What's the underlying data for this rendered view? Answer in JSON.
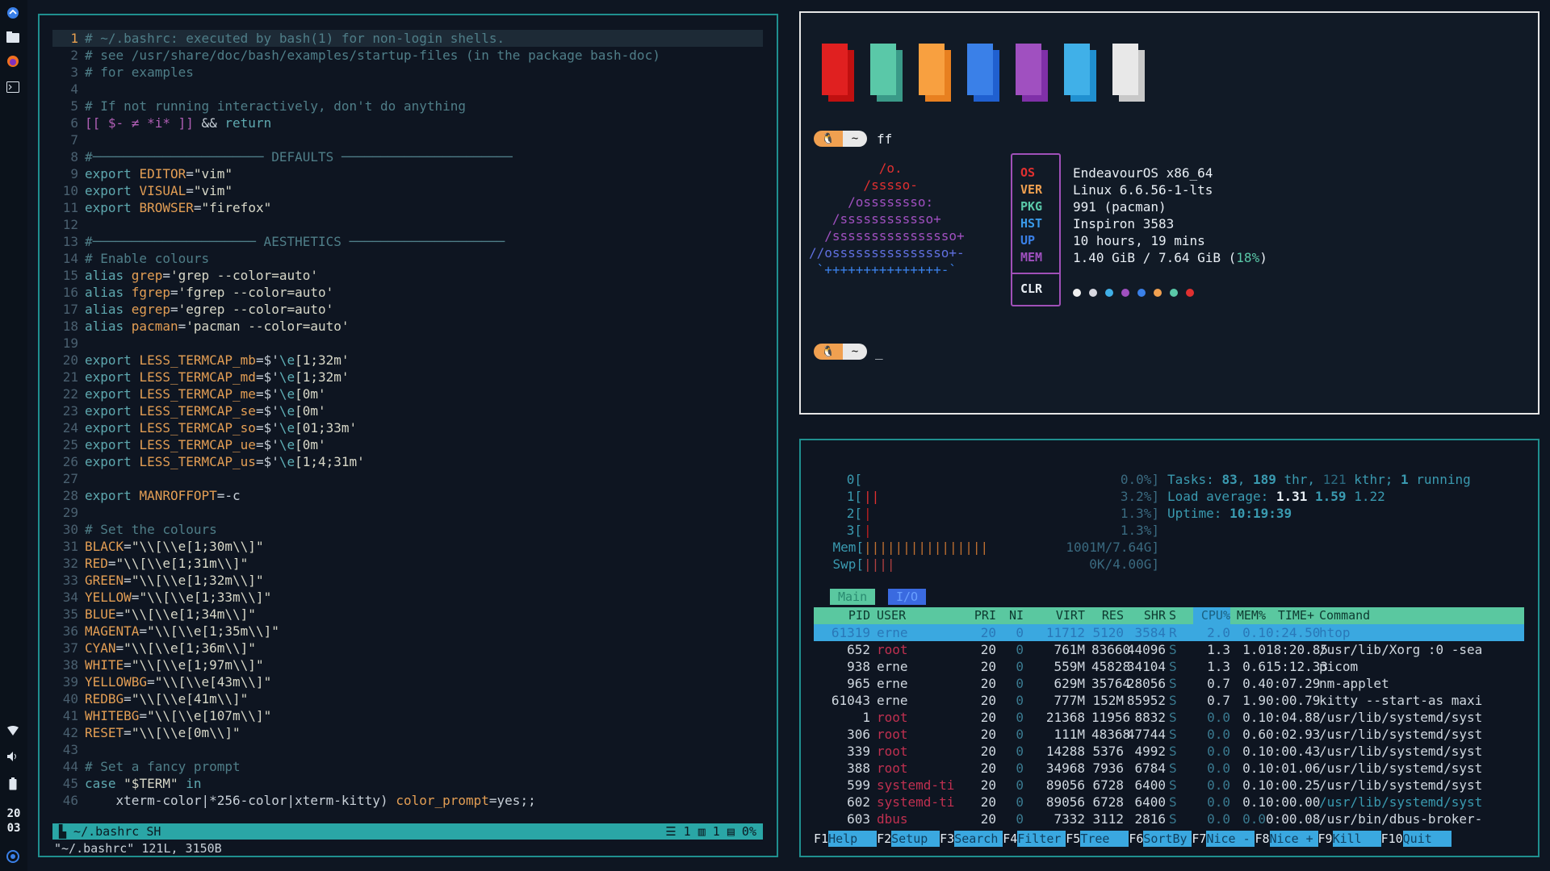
{
  "dock": {
    "icons": [
      "app-launcher-icon",
      "file-manager-icon",
      "firefox-icon",
      "terminal-icon"
    ],
    "tray_icons": [
      "wifi-icon",
      "volume-icon",
      "battery-icon",
      "power-icon"
    ],
    "clock_hour": "20",
    "clock_minute": "03"
  },
  "vim": {
    "lines": [
      {
        "n": "1",
        "segs": [
          [
            "c-com",
            "# ~/.bashrc: executed by bash(1) for non-login shells."
          ]
        ]
      },
      {
        "n": "2",
        "segs": [
          [
            "c-com",
            "# see /usr/share/doc/bash/examples/startup-files (in the package bash-doc)"
          ]
        ]
      },
      {
        "n": "3",
        "segs": [
          [
            "c-com",
            "# for examples"
          ]
        ]
      },
      {
        "n": "4",
        "segs": []
      },
      {
        "n": "5",
        "segs": [
          [
            "c-com",
            "# If not running interactively, don't do anything"
          ]
        ]
      },
      {
        "n": "6",
        "segs": [
          [
            "c-pur",
            "[[ $- ≠ *i* ]] "
          ],
          [
            "c-def",
            "&& "
          ],
          [
            "c-kw",
            "return"
          ]
        ]
      },
      {
        "n": "7",
        "segs": []
      },
      {
        "n": "8",
        "segs": [
          [
            "c-com",
            "#────────────────────── DEFAULTS ──────────────────────"
          ]
        ]
      },
      {
        "n": "9",
        "segs": [
          [
            "c-kw",
            "export "
          ],
          [
            "c-var",
            "EDITOR"
          ],
          [
            "c-def",
            "="
          ],
          [
            "c-str",
            "\"vim\""
          ]
        ]
      },
      {
        "n": "10",
        "segs": [
          [
            "c-kw",
            "export "
          ],
          [
            "c-var",
            "VISUAL"
          ],
          [
            "c-def",
            "="
          ],
          [
            "c-str",
            "\"vim\""
          ]
        ]
      },
      {
        "n": "11",
        "segs": [
          [
            "c-kw",
            "export "
          ],
          [
            "c-var",
            "BROWSER"
          ],
          [
            "c-def",
            "="
          ],
          [
            "c-str",
            "\"firefox\""
          ]
        ]
      },
      {
        "n": "12",
        "segs": []
      },
      {
        "n": "13",
        "segs": [
          [
            "c-com",
            "#───────────────────── AESTHETICS ────────────────────"
          ]
        ]
      },
      {
        "n": "14",
        "segs": [
          [
            "c-com",
            "# Enable colours"
          ]
        ]
      },
      {
        "n": "15",
        "segs": [
          [
            "c-kw",
            "alias "
          ],
          [
            "c-var",
            "grep"
          ],
          [
            "c-def",
            "="
          ],
          [
            "c-str",
            "'grep --color=auto'"
          ]
        ]
      },
      {
        "n": "16",
        "segs": [
          [
            "c-kw",
            "alias "
          ],
          [
            "c-var",
            "fgrep"
          ],
          [
            "c-def",
            "="
          ],
          [
            "c-str",
            "'fgrep --color=auto'"
          ]
        ]
      },
      {
        "n": "17",
        "segs": [
          [
            "c-kw",
            "alias "
          ],
          [
            "c-var",
            "egrep"
          ],
          [
            "c-def",
            "="
          ],
          [
            "c-str",
            "'egrep --color=auto'"
          ]
        ]
      },
      {
        "n": "18",
        "segs": [
          [
            "c-kw",
            "alias "
          ],
          [
            "c-var",
            "pacman"
          ],
          [
            "c-def",
            "="
          ],
          [
            "c-str",
            "'pacman --color=auto'"
          ]
        ]
      },
      {
        "n": "19",
        "segs": []
      },
      {
        "n": "20",
        "segs": [
          [
            "c-kw",
            "export "
          ],
          [
            "c-var",
            "LESS_TERMCAP_mb"
          ],
          [
            "c-def",
            "=$'"
          ],
          [
            "c-esc",
            "\\e"
          ],
          [
            "c-str",
            "[1;32m'"
          ]
        ]
      },
      {
        "n": "21",
        "segs": [
          [
            "c-kw",
            "export "
          ],
          [
            "c-var",
            "LESS_TERMCAP_md"
          ],
          [
            "c-def",
            "=$'"
          ],
          [
            "c-esc",
            "\\e"
          ],
          [
            "c-str",
            "[1;32m'"
          ]
        ]
      },
      {
        "n": "22",
        "segs": [
          [
            "c-kw",
            "export "
          ],
          [
            "c-var",
            "LESS_TERMCAP_me"
          ],
          [
            "c-def",
            "=$'"
          ],
          [
            "c-esc",
            "\\e"
          ],
          [
            "c-str",
            "[0m'"
          ]
        ]
      },
      {
        "n": "23",
        "segs": [
          [
            "c-kw",
            "export "
          ],
          [
            "c-var",
            "LESS_TERMCAP_se"
          ],
          [
            "c-def",
            "=$'"
          ],
          [
            "c-esc",
            "\\e"
          ],
          [
            "c-str",
            "[0m'"
          ]
        ]
      },
      {
        "n": "24",
        "segs": [
          [
            "c-kw",
            "export "
          ],
          [
            "c-var",
            "LESS_TERMCAP_so"
          ],
          [
            "c-def",
            "=$'"
          ],
          [
            "c-esc",
            "\\e"
          ],
          [
            "c-str",
            "[01;33m'"
          ]
        ]
      },
      {
        "n": "25",
        "segs": [
          [
            "c-kw",
            "export "
          ],
          [
            "c-var",
            "LESS_TERMCAP_ue"
          ],
          [
            "c-def",
            "=$'"
          ],
          [
            "c-esc",
            "\\e"
          ],
          [
            "c-str",
            "[0m'"
          ]
        ]
      },
      {
        "n": "26",
        "segs": [
          [
            "c-kw",
            "export "
          ],
          [
            "c-var",
            "LESS_TERMCAP_us"
          ],
          [
            "c-def",
            "=$'"
          ],
          [
            "c-esc",
            "\\e"
          ],
          [
            "c-str",
            "[1;4;31m'"
          ]
        ]
      },
      {
        "n": "27",
        "segs": []
      },
      {
        "n": "28",
        "segs": [
          [
            "c-kw",
            "export "
          ],
          [
            "c-var",
            "MANROFFOPT"
          ],
          [
            "c-def",
            "=-c"
          ]
        ]
      },
      {
        "n": "29",
        "segs": []
      },
      {
        "n": "30",
        "segs": [
          [
            "c-com",
            "# Set the colours"
          ]
        ]
      },
      {
        "n": "31",
        "segs": [
          [
            "c-var",
            "BLACK"
          ],
          [
            "c-def",
            "="
          ],
          [
            "c-str",
            "\"\\\\[\\\\e[1;30m\\\\]\""
          ]
        ]
      },
      {
        "n": "32",
        "segs": [
          [
            "c-var",
            "RED"
          ],
          [
            "c-def",
            "="
          ],
          [
            "c-str",
            "\"\\\\[\\\\e[1;31m\\\\]\""
          ]
        ]
      },
      {
        "n": "33",
        "segs": [
          [
            "c-var",
            "GREEN"
          ],
          [
            "c-def",
            "="
          ],
          [
            "c-str",
            "\"\\\\[\\\\e[1;32m\\\\]\""
          ]
        ]
      },
      {
        "n": "34",
        "segs": [
          [
            "c-var",
            "YELLOW"
          ],
          [
            "c-def",
            "="
          ],
          [
            "c-str",
            "\"\\\\[\\\\e[1;33m\\\\]\""
          ]
        ]
      },
      {
        "n": "35",
        "segs": [
          [
            "c-var",
            "BLUE"
          ],
          [
            "c-def",
            "="
          ],
          [
            "c-str",
            "\"\\\\[\\\\e[1;34m\\\\]\""
          ]
        ]
      },
      {
        "n": "36",
        "segs": [
          [
            "c-var",
            "MAGENTA"
          ],
          [
            "c-def",
            "="
          ],
          [
            "c-str",
            "\"\\\\[\\\\e[1;35m\\\\]\""
          ]
        ]
      },
      {
        "n": "37",
        "segs": [
          [
            "c-var",
            "CYAN"
          ],
          [
            "c-def",
            "="
          ],
          [
            "c-str",
            "\"\\\\[\\\\e[1;36m\\\\]\""
          ]
        ]
      },
      {
        "n": "38",
        "segs": [
          [
            "c-var",
            "WHITE"
          ],
          [
            "c-def",
            "="
          ],
          [
            "c-str",
            "\"\\\\[\\\\e[1;97m\\\\]\""
          ]
        ]
      },
      {
        "n": "39",
        "segs": [
          [
            "c-var",
            "YELLOWBG"
          ],
          [
            "c-def",
            "="
          ],
          [
            "c-str",
            "\"\\\\[\\\\e[43m\\\\]\""
          ]
        ]
      },
      {
        "n": "40",
        "segs": [
          [
            "c-var",
            "REDBG"
          ],
          [
            "c-def",
            "="
          ],
          [
            "c-str",
            "\"\\\\[\\\\e[41m\\\\]\""
          ]
        ]
      },
      {
        "n": "41",
        "segs": [
          [
            "c-var",
            "WHITEBG"
          ],
          [
            "c-def",
            "="
          ],
          [
            "c-str",
            "\"\\\\[\\\\e[107m\\\\]\""
          ]
        ]
      },
      {
        "n": "42",
        "segs": [
          [
            "c-var",
            "RESET"
          ],
          [
            "c-def",
            "="
          ],
          [
            "c-str",
            "\"\\\\[\\\\e[0m\\\\]\""
          ]
        ]
      },
      {
        "n": "43",
        "segs": []
      },
      {
        "n": "44",
        "segs": [
          [
            "c-com",
            "# Set a fancy prompt"
          ]
        ]
      },
      {
        "n": "45",
        "segs": [
          [
            "c-kw",
            "case "
          ],
          [
            "c-str",
            "\"$TERM\" "
          ],
          [
            "c-kw",
            "in"
          ]
        ]
      },
      {
        "n": "46",
        "segs": [
          [
            "c-def",
            "    xterm-color|*256-color|xterm-kitty) "
          ],
          [
            "c-var",
            "color_prompt"
          ],
          [
            "c-def",
            "=yes;;"
          ]
        ]
      }
    ],
    "status_left": "▙ ~/.bashrc  SH",
    "status_right": "☰ 1 ▥ 1 ▤ 0%",
    "cmdline": "\"~/.bashrc\" 121L, 3150B"
  },
  "fastfetch": {
    "swatch_colors": [
      [
        "#e02020",
        "#c01010"
      ],
      [
        "#5ac8a8",
        "#3a9a88"
      ],
      [
        "#f8a040",
        "#e88020"
      ],
      [
        "#3a80e8",
        "#2060d0"
      ],
      [
        "#a050c0",
        "#8030a8"
      ],
      [
        "#40b0e8",
        "#2090d0"
      ],
      [
        "#e8e8e8",
        "#c8c8c8"
      ]
    ],
    "prompt_icon": "🐧",
    "prompt_dir": "~",
    "prompt_cmd": "ff",
    "prompt2_cursor": "_",
    "logo_lines": [
      "         /o.",
      "       /sssso-",
      "     /ossssssso:",
      "   /ssssssssssso+",
      "  /ssssssssssssssso+",
      "//osssssssssssssso+-",
      " `+++++++++++++++-`"
    ],
    "logo_colors": [
      "#e03030",
      "#e03030",
      "#a050c0",
      "#a050c0",
      "#a050c0",
      "#6070e0",
      "#3a80e8"
    ],
    "keys": [
      {
        "k": "OS",
        "c": "#e03030"
      },
      {
        "k": "VER",
        "c": "#f0a050"
      },
      {
        "k": "PKG",
        "c": "#5ac8a8"
      },
      {
        "k": "HST",
        "c": "#3a9ae8"
      },
      {
        "k": "UP",
        "c": "#3a80e8"
      },
      {
        "k": "MEM",
        "c": "#a050c0"
      }
    ],
    "clr_key": "CLR",
    "values": [
      "EndeavourOS x86_64",
      "Linux 6.6.56-1-lts",
      "991 (pacman)",
      "Inspiron 3583",
      "10 hours, 19 mins"
    ],
    "mem_value": "1.40 GiB / 7.64 GiB (",
    "mem_pct": "18%",
    "mem_close": ")",
    "dots": [
      "#f0f0f0",
      "#d8d8e0",
      "#40b0e8",
      "#a050c0",
      "#3a80e8",
      "#f0a050",
      "#5ac8a8",
      "#e03030"
    ]
  },
  "htop": {
    "cpus": [
      {
        "id": "0[",
        "pct": "0.0%]"
      },
      {
        "id": "1[",
        "pct": "3.2%]"
      },
      {
        "id": "2[",
        "pct": "1.3%]"
      },
      {
        "id": "3[",
        "pct": "1.3%]"
      }
    ],
    "mem_label": "Mem[",
    "mem_bar": "||||||||||||||||",
    "mem_val": "1001M/7.64G]",
    "swp_label": "Swp[",
    "swp_bar": "||||",
    "swp_val": "0K/4.00G]",
    "tasks_label": "Tasks: ",
    "tasks_a": "83",
    "tasks_b": "189",
    "tasks_thr": " thr, ",
    "tasks_c": "121",
    "tasks_kthr": " kthr; ",
    "tasks_d": "1",
    "tasks_run": " running",
    "load_label": "Load average: ",
    "load1": "1.31",
    "load5": "1.59",
    "load15": "1.22",
    "uptime_label": "Uptime: ",
    "uptime": "10:19:39",
    "tab_main": "Main",
    "tab_io": "I/O",
    "headers": [
      "PID",
      "USER",
      "PRI",
      "NI",
      "VIRT",
      "RES",
      "SHR",
      "S",
      "CPU%",
      "MEM%",
      "TIME+",
      "Command"
    ],
    "rows": [
      [
        "61319",
        "erne",
        "20",
        "0",
        "11712",
        "5120",
        "3584",
        "R",
        "2.0",
        "0.1",
        "0:24.50",
        "htop"
      ],
      [
        "652",
        "root",
        "20",
        "0",
        "761M",
        "83660",
        "44096",
        "S",
        "1.3",
        "1.0",
        "18:20.85",
        "/usr/lib/Xorg :0 -sea"
      ],
      [
        "938",
        "erne",
        "20",
        "0",
        "559M",
        "45828",
        "34104",
        "S",
        "1.3",
        "0.6",
        "15:12.33",
        "picom"
      ],
      [
        "965",
        "erne",
        "20",
        "0",
        "629M",
        "35764",
        "28056",
        "S",
        "0.7",
        "0.4",
        "0:07.29",
        "nm-applet"
      ],
      [
        "61043",
        "erne",
        "20",
        "0",
        "777M",
        "152M",
        "85952",
        "S",
        "0.7",
        "1.9",
        "0:00.79",
        "kitty --start-as maxi"
      ],
      [
        "1",
        "root",
        "20",
        "0",
        "21368",
        "11956",
        "8832",
        "S",
        "0.0",
        "0.1",
        "0:04.88",
        "/usr/lib/systemd/syst"
      ],
      [
        "306",
        "root",
        "20",
        "0",
        "111M",
        "48368",
        "47744",
        "S",
        "0.0",
        "0.6",
        "0:02.93",
        "/usr/lib/systemd/syst"
      ],
      [
        "339",
        "root",
        "20",
        "0",
        "14288",
        "5376",
        "4992",
        "S",
        "0.0",
        "0.1",
        "0:00.43",
        "/usr/lib/systemd/syst"
      ],
      [
        "388",
        "root",
        "20",
        "0",
        "34968",
        "7936",
        "6784",
        "S",
        "0.0",
        "0.1",
        "0:01.06",
        "/usr/lib/systemd/syst"
      ],
      [
        "599",
        "systemd-ti",
        "20",
        "0",
        "89056",
        "6728",
        "6400",
        "S",
        "0.0",
        "0.1",
        "0:00.25",
        "/usr/lib/systemd/syst"
      ],
      [
        "602",
        "systemd-ti",
        "20",
        "0",
        "89056",
        "6728",
        "6400",
        "S",
        "0.0",
        "0.1",
        "0:00.00",
        "/usr/lib/systemd/syst"
      ],
      [
        "603",
        "dbus",
        "20",
        "0",
        "7332",
        "3112",
        "2816",
        "S",
        "0.0",
        "0.0",
        "0:00.08",
        "/usr/bin/dbus-broker-"
      ]
    ],
    "fkeys": [
      {
        "k": "F1",
        "l": "Help  "
      },
      {
        "k": "F2",
        "l": "Setup "
      },
      {
        "k": "F3",
        "l": "Search"
      },
      {
        "k": "F4",
        "l": "Filter"
      },
      {
        "k": "F5",
        "l": "Tree  "
      },
      {
        "k": "F6",
        "l": "SortBy"
      },
      {
        "k": "F7",
        "l": "Nice -"
      },
      {
        "k": "F8",
        "l": "Nice +"
      },
      {
        "k": "F9",
        "l": "Kill  "
      },
      {
        "k": "F10",
        "l": "Quit  "
      }
    ]
  }
}
